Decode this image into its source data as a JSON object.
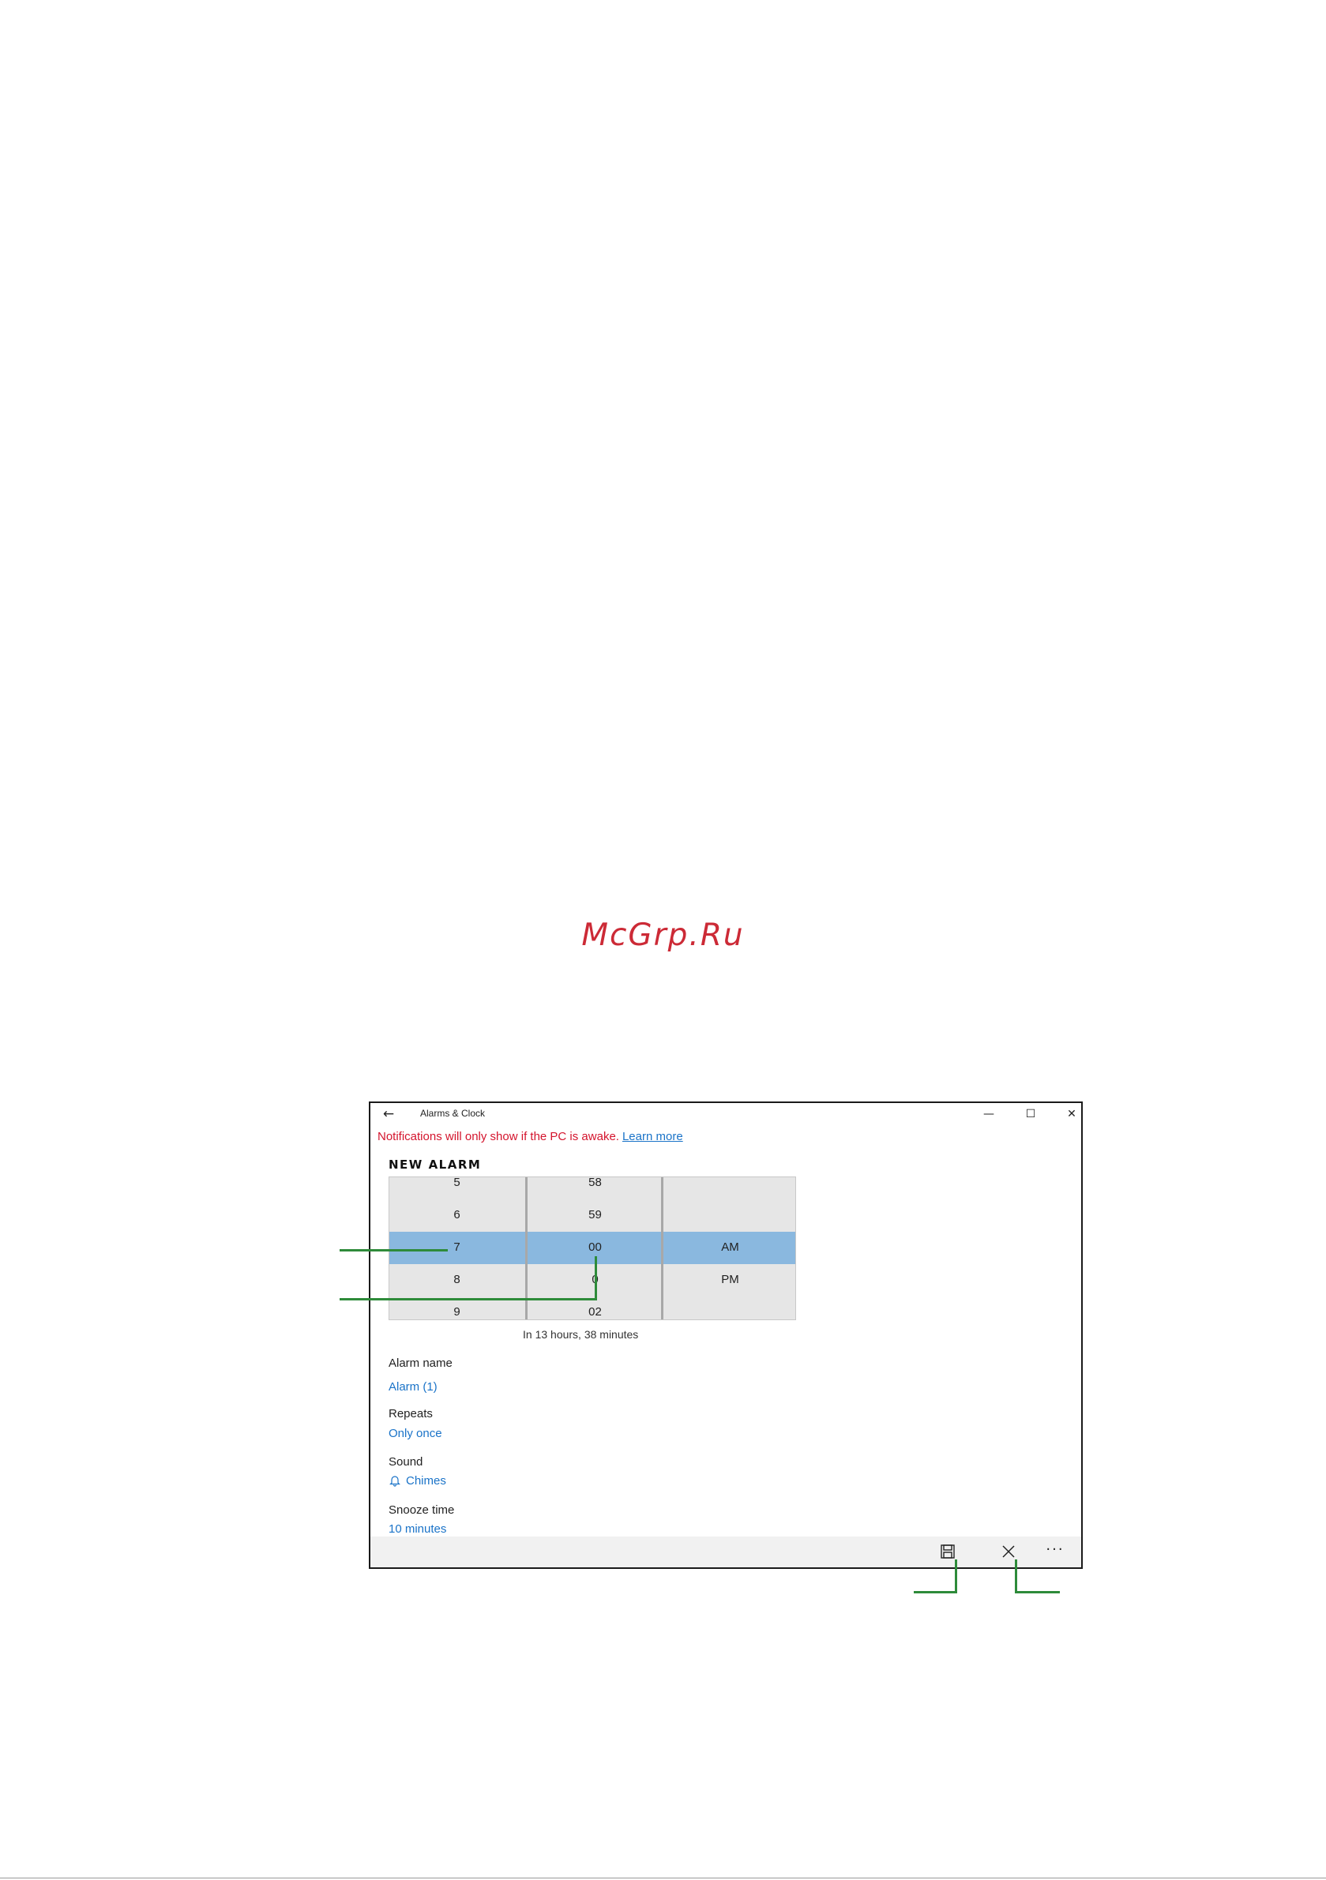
{
  "watermark": "McGrp.Ru",
  "window": {
    "title": "Alarms & Clock",
    "back_icon": "arrow-left-icon",
    "minimize_glyph": "—",
    "maximize_glyph": "☐",
    "close_glyph": "✕"
  },
  "notice": {
    "text": "Notifications will only show if the PC is awake.",
    "link": "Learn more"
  },
  "new_alarm": {
    "heading": "NEW ALARM",
    "picker": {
      "hours": [
        "5",
        "6",
        "7",
        "8",
        "9"
      ],
      "minutes": [
        "58",
        "59",
        "00",
        "0",
        "02"
      ],
      "periods": [
        "AM",
        "PM"
      ],
      "selected": {
        "hour": "7",
        "minute": "00",
        "period": "AM"
      }
    },
    "countdown": "In 13 hours, 38 minutes",
    "fields": {
      "alarm_name_label": "Alarm name",
      "alarm_name_value": "Alarm (1)",
      "repeats_label": "Repeats",
      "repeats_value": "Only once",
      "sound_label": "Sound",
      "sound_value": "Chimes",
      "sound_icon": "bell-icon",
      "snooze_label": "Snooze time",
      "snooze_value": "10 minutes"
    }
  },
  "command_bar": {
    "save_icon": "save-icon",
    "cancel_icon": "close-icon",
    "more_label": "···"
  },
  "colors": {
    "selection": "#8ab8df",
    "notice_red": "#d4142d",
    "link_blue": "#1a73c8",
    "callout_green": "#2e8b3a",
    "watermark_red": "#cc2a36"
  }
}
